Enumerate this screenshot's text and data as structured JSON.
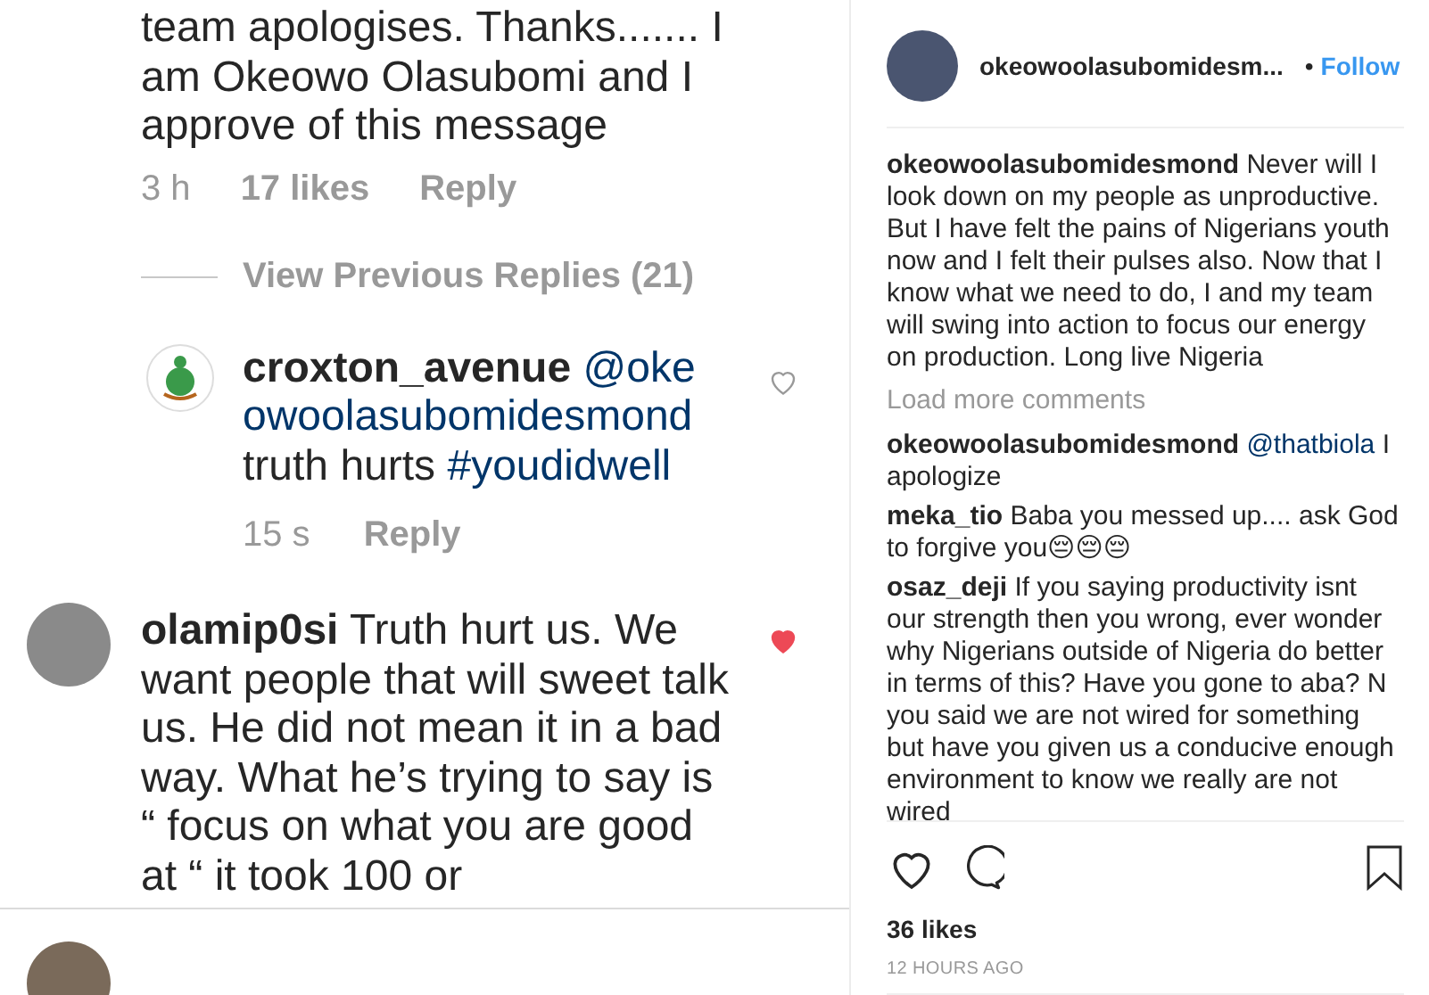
{
  "mobile_thread": {
    "parent_comment": {
      "text": "team apologises. Thanks....... I am Okeowo Olasubomi and I approve of this message",
      "time": "3 h",
      "likes": "17 likes",
      "reply": "Reply"
    },
    "view_replies": "View Previous Replies (21)",
    "reply": {
      "segments": [
        {
          "kind": "user",
          "text": "croxton_avenue"
        },
        {
          "kind": "mention",
          "text": "@okeowoolasubomidesmond"
        },
        {
          "kind": "text",
          "text": "truth hurts"
        },
        {
          "kind": "mention",
          "text": "#youdidwell"
        }
      ],
      "time": "15 s",
      "reply": "Reply",
      "liked": false
    },
    "comment": {
      "segments": [
        {
          "kind": "user",
          "text": "olamip0si"
        },
        {
          "kind": "text",
          "text": "Truth hurt us. We want people that will sweet talk us. He did not mean it in a bad way. What he’s trying to say is “ focus on what you are good at “ it took 100 or"
        }
      ],
      "liked": true
    }
  },
  "post_panel": {
    "header": {
      "username": "okeowoolasubomidesm...",
      "separator": "•",
      "follow": "Follow"
    },
    "caption": [
      {
        "kind": "user",
        "text": "okeowoolasubomidesmond"
      },
      {
        "kind": "text",
        "text": "Never will I look down on my people as unproductive. But I have felt the pains of Nigerians youth now and I felt their pulses also. Now that I know what we need to do, I and my team will swing into action to focus our energy on production. Long live Nigeria"
      }
    ],
    "load_more": "Load more comments",
    "comments": [
      [
        {
          "kind": "user",
          "text": "okeowoolasubomidesmond"
        },
        {
          "kind": "mention",
          "text": "@thatbiola"
        },
        {
          "kind": "text",
          "text": "I apologize"
        }
      ],
      [
        {
          "kind": "user",
          "text": "meka_tio"
        },
        {
          "kind": "text",
          "text": "Baba you messed up.... ask God to forgive you😔😔😔"
        }
      ],
      [
        {
          "kind": "user",
          "text": "osaz_deji"
        },
        {
          "kind": "text",
          "text": "If you saying productivity isnt our strength then you wrong, ever wonder why Nigerians outside of Nigeria do better in terms of this? Have you gone to aba? N you said we are not wired for something but have you given us a conducive enough environment to know we really are not wired"
        }
      ]
    ],
    "liked": false,
    "saved": false,
    "likes": "36 likes",
    "time": "12 HOURS AGO"
  }
}
